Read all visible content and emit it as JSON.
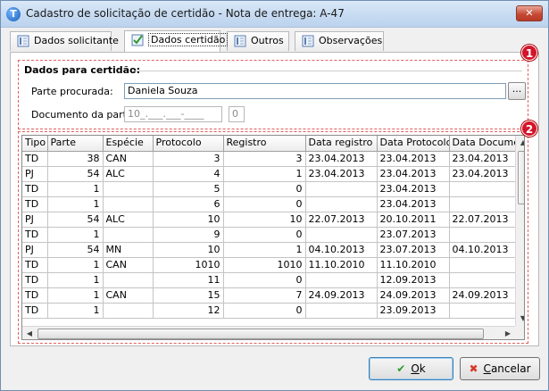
{
  "window": {
    "title": "Cadastro de solicitação de certidão - Nota de entrega: A-47",
    "app_icon_letter": "T",
    "close_label": "✕"
  },
  "tabs": [
    {
      "label": "Dados solicitante",
      "active": false
    },
    {
      "label": "Dados certidão",
      "active": true
    },
    {
      "label": "Outros",
      "active": false
    },
    {
      "label": "Observações",
      "active": false
    }
  ],
  "certidao": {
    "group_title": "Dados para certidão:",
    "parte_label": "Parte procurada:",
    "parte_value": "Daniela Souza",
    "lookup_label": "...",
    "documento_label": "Documento da parte:",
    "documento_mask": "10_.___.___-____",
    "documento_digit": "0"
  },
  "badges": [
    "1",
    "2"
  ],
  "grid": {
    "columns": [
      "Tipo",
      "Parte",
      "Espécie",
      "Protocolo",
      "Registro",
      "Data registro",
      "Data Protocolo",
      "Data Documen"
    ],
    "rows": [
      [
        "TD",
        "38",
        "CAN",
        "3",
        "3",
        "23.04.2013",
        "23.04.2013",
        "23.04.2013"
      ],
      [
        "PJ",
        "54",
        "ALC",
        "4",
        "1",
        "23.04.2013",
        "23.04.2013",
        "23.04.2013"
      ],
      [
        "TD",
        "1",
        "",
        "5",
        "0",
        "",
        "23.04.2013",
        ""
      ],
      [
        "TD",
        "1",
        "",
        "6",
        "0",
        "",
        "23.04.2013",
        ""
      ],
      [
        "PJ",
        "54",
        "ALC",
        "10",
        "10",
        "22.07.2013",
        "20.10.2011",
        "22.07.2013"
      ],
      [
        "TD",
        "1",
        "",
        "9",
        "0",
        "",
        "23.07.2013",
        ""
      ],
      [
        "PJ",
        "54",
        "MN",
        "10",
        "1",
        "04.10.2013",
        "23.07.2013",
        "04.10.2013"
      ],
      [
        "TD",
        "1",
        "CAN",
        "1010",
        "1010",
        "11.10.2010",
        "11.10.2010",
        ""
      ],
      [
        "TD",
        "1",
        "",
        "11",
        "0",
        "",
        "12.09.2013",
        ""
      ],
      [
        "TD",
        "1",
        "CAN",
        "15",
        "7",
        "24.09.2013",
        "24.09.2013",
        "24.09.2013"
      ],
      [
        "TD",
        "1",
        "",
        "12",
        "0",
        "",
        "23.09.2013",
        ""
      ]
    ]
  },
  "buttons": {
    "ok_underlined": "O",
    "ok_rest": "k",
    "cancel_underlined": "C",
    "cancel_rest": "ancelar"
  },
  "colors": {
    "badge": "#d4142a",
    "ok_icon": "#2f9a2f",
    "cancel_icon": "#d43a2a"
  }
}
